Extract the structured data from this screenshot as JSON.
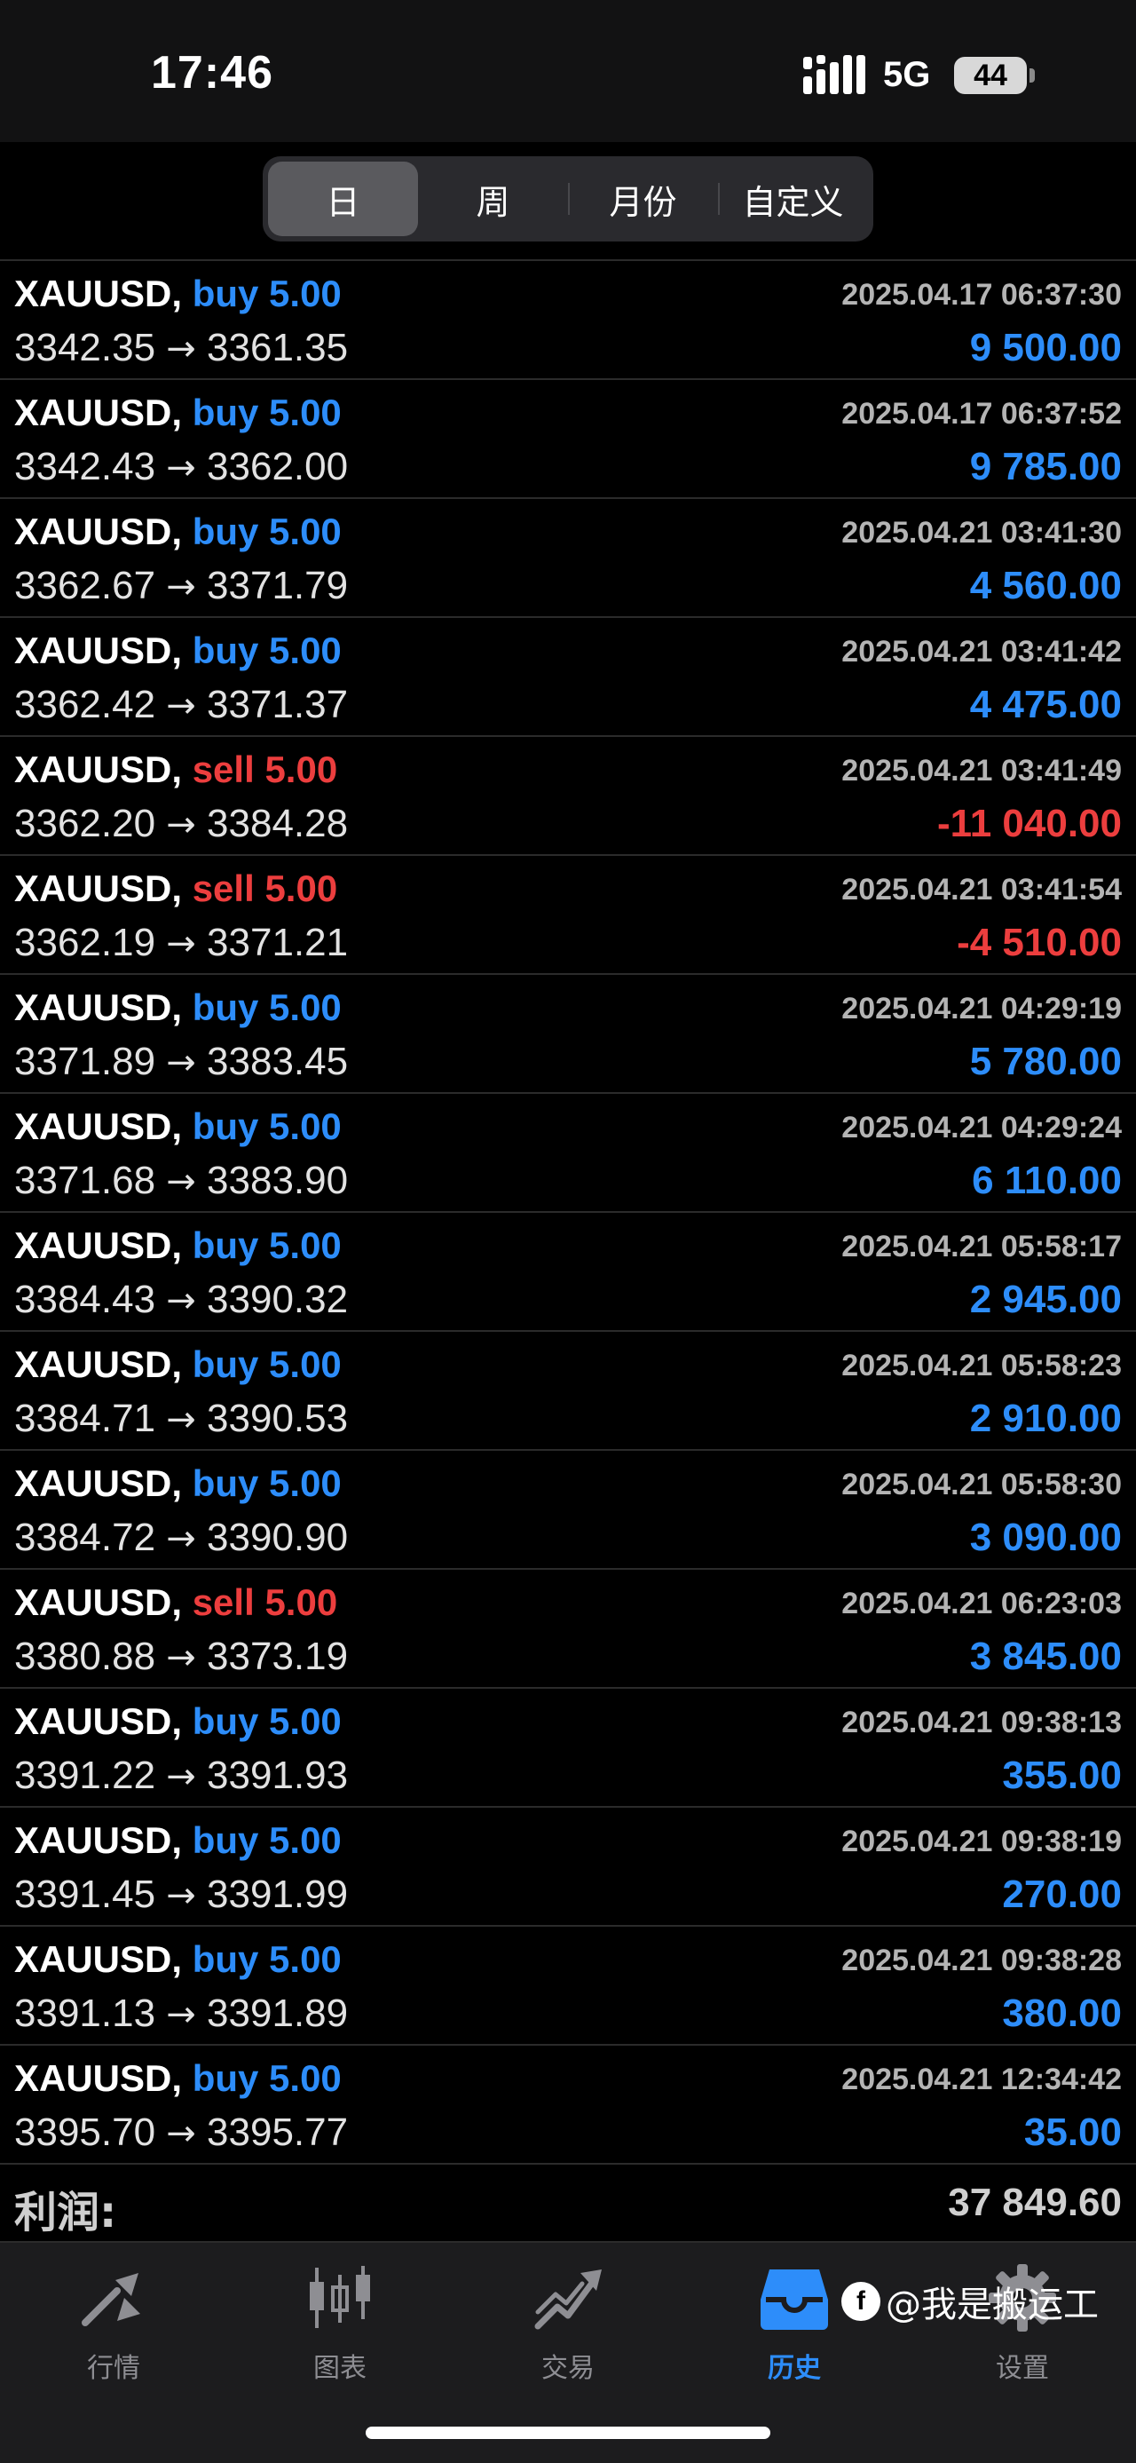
{
  "status_bar": {
    "time": "17:46",
    "network": "5G",
    "battery": "44"
  },
  "period_tabs": [
    {
      "label": "日",
      "active": true
    },
    {
      "label": "周",
      "active": false
    },
    {
      "label": "月份",
      "active": false
    },
    {
      "label": "自定义",
      "active": false
    }
  ],
  "deals": [
    {
      "symbol": "XAUUSD,",
      "side": "buy",
      "volume": "5.00",
      "time": "2025.04.17 06:37:30",
      "open": "3342.35",
      "close": "3361.35",
      "profit": "9 500.00"
    },
    {
      "symbol": "XAUUSD,",
      "side": "buy",
      "volume": "5.00",
      "time": "2025.04.17 06:37:52",
      "open": "3342.43",
      "close": "3362.00",
      "profit": "9 785.00"
    },
    {
      "symbol": "XAUUSD,",
      "side": "buy",
      "volume": "5.00",
      "time": "2025.04.21 03:41:30",
      "open": "3362.67",
      "close": "3371.79",
      "profit": "4 560.00"
    },
    {
      "symbol": "XAUUSD,",
      "side": "buy",
      "volume": "5.00",
      "time": "2025.04.21 03:41:42",
      "open": "3362.42",
      "close": "3371.37",
      "profit": "4 475.00"
    },
    {
      "symbol": "XAUUSD,",
      "side": "sell",
      "volume": "5.00",
      "time": "2025.04.21 03:41:49",
      "open": "3362.20",
      "close": "3384.28",
      "profit": "-11 040.00"
    },
    {
      "symbol": "XAUUSD,",
      "side": "sell",
      "volume": "5.00",
      "time": "2025.04.21 03:41:54",
      "open": "3362.19",
      "close": "3371.21",
      "profit": "-4 510.00"
    },
    {
      "symbol": "XAUUSD,",
      "side": "buy",
      "volume": "5.00",
      "time": "2025.04.21 04:29:19",
      "open": "3371.89",
      "close": "3383.45",
      "profit": "5 780.00"
    },
    {
      "symbol": "XAUUSD,",
      "side": "buy",
      "volume": "5.00",
      "time": "2025.04.21 04:29:24",
      "open": "3371.68",
      "close": "3383.90",
      "profit": "6 110.00"
    },
    {
      "symbol": "XAUUSD,",
      "side": "buy",
      "volume": "5.00",
      "time": "2025.04.21 05:58:17",
      "open": "3384.43",
      "close": "3390.32",
      "profit": "2 945.00"
    },
    {
      "symbol": "XAUUSD,",
      "side": "buy",
      "volume": "5.00",
      "time": "2025.04.21 05:58:23",
      "open": "3384.71",
      "close": "3390.53",
      "profit": "2 910.00"
    },
    {
      "symbol": "XAUUSD,",
      "side": "buy",
      "volume": "5.00",
      "time": "2025.04.21 05:58:30",
      "open": "3384.72",
      "close": "3390.90",
      "profit": "3 090.00"
    },
    {
      "symbol": "XAUUSD,",
      "side": "sell",
      "volume": "5.00",
      "time": "2025.04.21 06:23:03",
      "open": "3380.88",
      "close": "3373.19",
      "profit": "3 845.00"
    },
    {
      "symbol": "XAUUSD,",
      "side": "buy",
      "volume": "5.00",
      "time": "2025.04.21 09:38:13",
      "open": "3391.22",
      "close": "3391.93",
      "profit": "355.00"
    },
    {
      "symbol": "XAUUSD,",
      "side": "buy",
      "volume": "5.00",
      "time": "2025.04.21 09:38:19",
      "open": "3391.45",
      "close": "3391.99",
      "profit": "270.00"
    },
    {
      "symbol": "XAUUSD,",
      "side": "buy",
      "volume": "5.00",
      "time": "2025.04.21 09:38:28",
      "open": "3391.13",
      "close": "3391.89",
      "profit": "380.00"
    },
    {
      "symbol": "XAUUSD,",
      "side": "buy",
      "volume": "5.00",
      "time": "2025.04.21 12:34:42",
      "open": "3395.70",
      "close": "3395.77",
      "profit": "35.00"
    }
  ],
  "summary": {
    "label": "利润:",
    "value": "37 849.60"
  },
  "tab_bar": [
    {
      "label": "行情",
      "icon": "quotes-icon",
      "active": false
    },
    {
      "label": "图表",
      "icon": "chart-icon",
      "active": false
    },
    {
      "label": "交易",
      "icon": "trade-icon",
      "active": false
    },
    {
      "label": "历史",
      "icon": "history-icon",
      "active": true
    },
    {
      "label": "设置",
      "icon": "settings-icon",
      "active": false
    }
  ],
  "watermark": {
    "text": "@我是搬运工"
  },
  "colors": {
    "buy": "#2d8dfa",
    "sell": "#ec3e3e",
    "background": "#000000",
    "tab_active": "#2d8dfa",
    "tab_inactive": "#8e8e93"
  }
}
